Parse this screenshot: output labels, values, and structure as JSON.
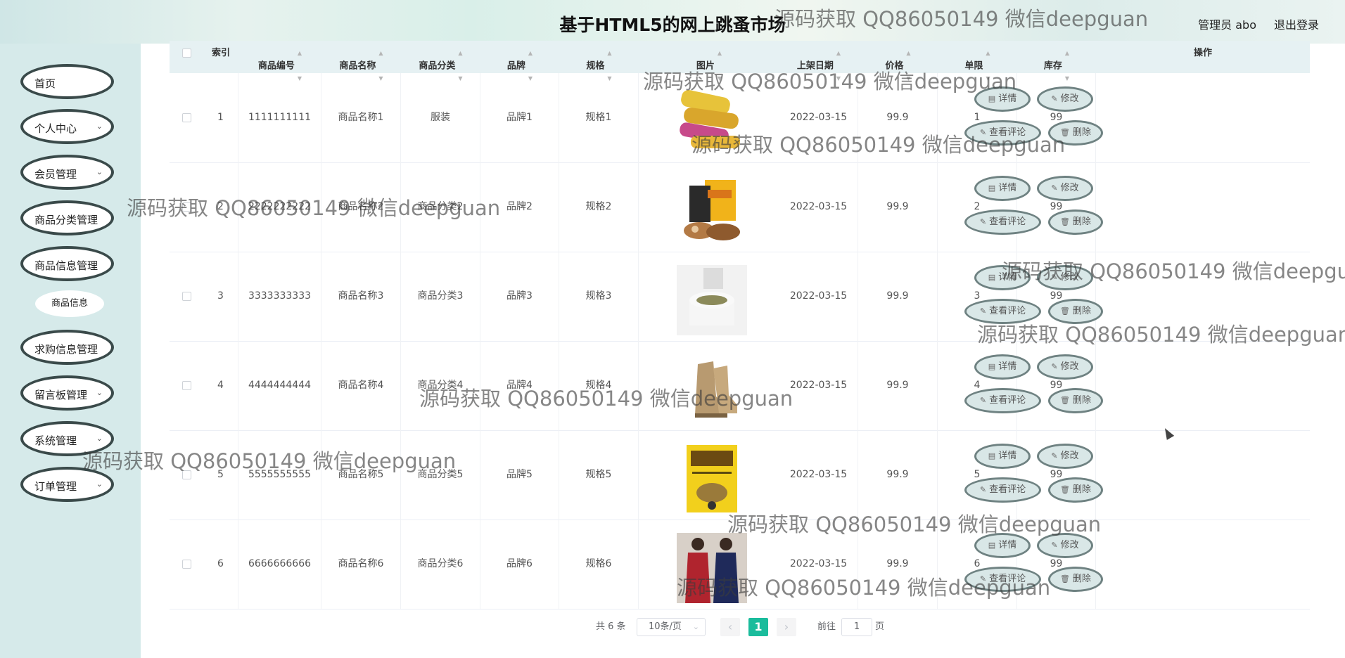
{
  "header": {
    "title": "基于HTML5的网上跳蚤市场",
    "admin": "管理员 abo",
    "logout": "退出登录"
  },
  "sidebar": {
    "items": [
      {
        "label": "首页",
        "chevron": ""
      },
      {
        "label": "个人中心",
        "chevron": "⌄"
      },
      {
        "label": "会员管理",
        "chevron": "⌄"
      },
      {
        "label": "商品分类管理",
        "chevron": ""
      },
      {
        "label": "商品信息管理",
        "chevron": ""
      },
      {
        "label": "求购信息管理",
        "chevron": ""
      },
      {
        "label": "留言板管理",
        "chevron": "⌄"
      },
      {
        "label": "系统管理",
        "chevron": "⌄"
      },
      {
        "label": "订单管理",
        "chevron": "⌄"
      }
    ],
    "sub_item": "商品信息"
  },
  "table": {
    "columns": [
      "索引",
      "商品编号",
      "商品名称",
      "商品分类",
      "品牌",
      "规格",
      "图片",
      "上架日期",
      "价格",
      "单限",
      "库存",
      "操作"
    ],
    "rows": [
      {
        "index": "1",
        "code": "1111111111",
        "name": "商品名称1",
        "category": "服装",
        "brand": "品牌1",
        "spec": "规格1",
        "image": "snack-rolls-image",
        "date": "2022-03-15",
        "price": "99.9",
        "limit": "1",
        "stock": "99"
      },
      {
        "index": "2",
        "code": "2222222222",
        "name": "商品名称2",
        "category": "商品分类2",
        "brand": "品牌2",
        "spec": "规格2",
        "image": "snack-pack-image",
        "date": "2022-03-15",
        "price": "99.9",
        "limit": "2",
        "stock": "99"
      },
      {
        "index": "3",
        "code": "3333333333",
        "name": "商品名称3",
        "category": "商品分类3",
        "brand": "品牌3",
        "spec": "规格3",
        "image": "cream-jar-image",
        "date": "2022-03-15",
        "price": "99.9",
        "limit": "3",
        "stock": "99"
      },
      {
        "index": "4",
        "code": "4444444444",
        "name": "商品名称4",
        "category": "商品分类4",
        "brand": "品牌4",
        "spec": "规格4",
        "image": "boots-image",
        "date": "2022-03-15",
        "price": "99.9",
        "limit": "4",
        "stock": "99"
      },
      {
        "index": "5",
        "code": "5555555555",
        "name": "商品名称5",
        "category": "商品分类5",
        "brand": "品牌5",
        "spec": "规格5",
        "image": "book-image",
        "date": "2022-03-15",
        "price": "99.9",
        "limit": "5",
        "stock": "99"
      },
      {
        "index": "6",
        "code": "6666666666",
        "name": "商品名称6",
        "category": "商品分类6",
        "brand": "品牌6",
        "spec": "规格6",
        "image": "women-clothing-image",
        "date": "2022-03-15",
        "price": "99.9",
        "limit": "6",
        "stock": "99"
      }
    ],
    "actions": {
      "detail": "详情",
      "edit": "修改",
      "comments": "查看评论",
      "delete": "删除"
    }
  },
  "pagination": {
    "total": "共 6 条",
    "page_size": "10条/页",
    "current_page": "1",
    "goto_prefix": "前往",
    "goto_value": "1",
    "goto_suffix": "页"
  },
  "watermark": "源码获取 QQ86050149 微信deepguan"
}
